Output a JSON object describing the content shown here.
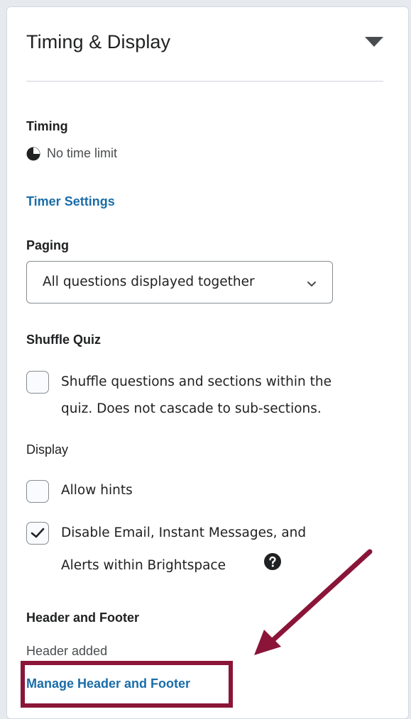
{
  "panel": {
    "title": "Timing & Display",
    "toggle_icon": "caret-down-icon"
  },
  "timing": {
    "heading": "Timing",
    "status_icon": "clock-icon",
    "status_text": "No time limit",
    "link_label": "Timer Settings"
  },
  "paging": {
    "heading": "Paging",
    "selected_option": "All questions displayed together",
    "chevron_icon": "chevron-down-icon"
  },
  "shuffle": {
    "heading": "Shuffle Quiz",
    "checkbox_checked": false,
    "label_line1": "Shuffle questions and sections within the",
    "label_line2": "quiz. Does not cascade to sub-sections."
  },
  "display": {
    "heading": "Display",
    "allow_hints_label": "Allow hints",
    "allow_hints_checked": false,
    "disable_email_line1": "Disable Email, Instant Messages, and",
    "disable_email_line2": "Alerts within Brightspace",
    "disable_email_checked": true,
    "help_icon": "help-icon"
  },
  "header_footer": {
    "heading": "Header and Footer",
    "status_text": "Header added",
    "link_label": "Manage Header and Footer"
  },
  "colors": {
    "link": "#1a6da8",
    "annotation": "#8a1538",
    "text": "#202122"
  }
}
